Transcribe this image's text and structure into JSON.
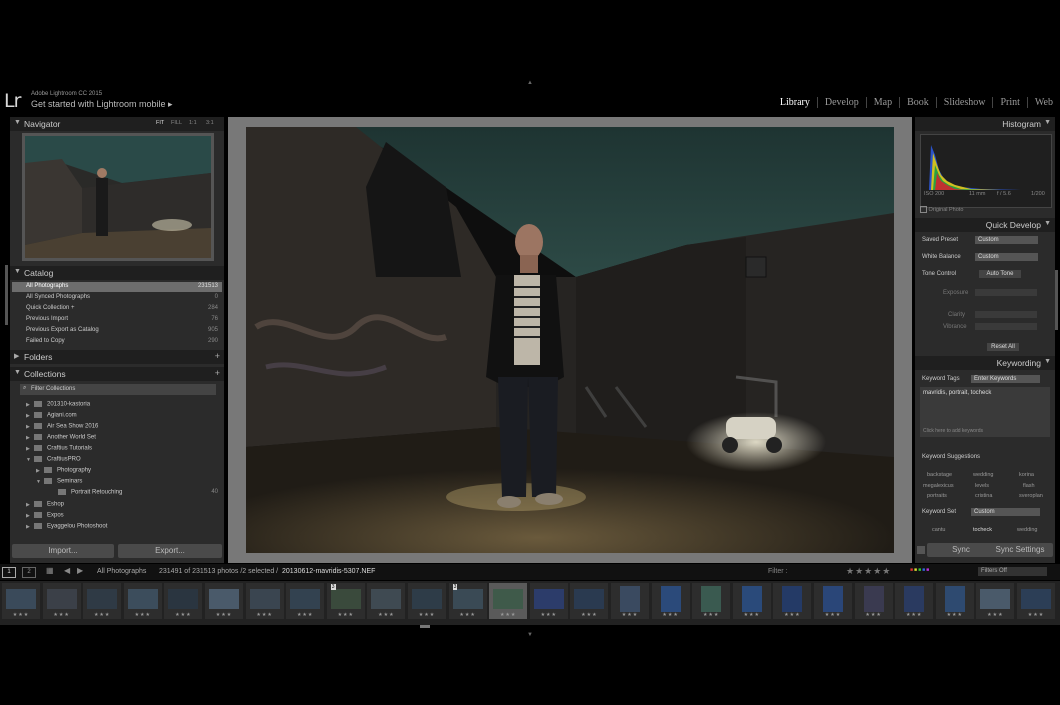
{
  "header": {
    "logo": "Lr",
    "app_name": "Adobe Lightroom CC 2015",
    "get_started": "Get started with Lightroom mobile ▸"
  },
  "modules": [
    "Library",
    "Develop",
    "Map",
    "Book",
    "Slideshow",
    "Print",
    "Web"
  ],
  "active_module": "Library",
  "navigator": {
    "title": "Navigator",
    "zoom": [
      "FIT",
      "FILL",
      "1:1",
      "3:1"
    ]
  },
  "catalog": {
    "title": "Catalog",
    "items": [
      {
        "label": "All Photographs",
        "count": "231513"
      },
      {
        "label": "All Synced Photographs",
        "count": "0"
      },
      {
        "label": "Quick Collection +",
        "count": "284"
      },
      {
        "label": "Previous Import",
        "count": "76"
      },
      {
        "label": "Previous Export as Catalog",
        "count": "905"
      },
      {
        "label": "Failed to Copy",
        "count": "290"
      }
    ]
  },
  "folders": {
    "title": "Folders"
  },
  "collections": {
    "title": "Collections",
    "filter": "Filter Collections",
    "items": [
      {
        "label": "201310-kastoria",
        "count": ""
      },
      {
        "label": "Agiani.com",
        "count": ""
      },
      {
        "label": "Air Sea Show 2016",
        "count": ""
      },
      {
        "label": "Another World Set",
        "count": ""
      },
      {
        "label": "Craftius Tutorials",
        "count": ""
      },
      {
        "label": "CraftiusPRO",
        "count": ""
      },
      {
        "label": "Photography",
        "count": ""
      },
      {
        "label": "Seminars",
        "count": ""
      },
      {
        "label": "Portrait Retouching",
        "count": "40"
      },
      {
        "label": "Eshop",
        "count": ""
      },
      {
        "label": "Expos",
        "count": ""
      },
      {
        "label": "Eyaggelou Photoshoot",
        "count": ""
      }
    ]
  },
  "left_buttons": {
    "import": "Import...",
    "export": "Export..."
  },
  "histogram": {
    "title": "Histogram",
    "iso": "ISO 200",
    "focal": "11 mm",
    "aperture": "f / 5.6",
    "shutter": "1/200",
    "original_photo": "Original Photo"
  },
  "quick_develop": {
    "title": "Quick Develop",
    "saved_preset_label": "Saved Preset",
    "saved_preset_value": "Custom",
    "white_balance_label": "White Balance",
    "white_balance_value": "Custom",
    "tone_control_label": "Tone Control",
    "auto_tone": "Auto Tone",
    "exposure": "Exposure",
    "clarity": "Clarity",
    "vibrance": "Vibrance",
    "reset_all": "Reset All"
  },
  "keywording": {
    "title": "Keywording",
    "tags_label": "Keyword Tags",
    "tags_mode": "Enter Keywords",
    "keywords": "mavridis, portrait, tocheck",
    "add_hint": "Click here to add keywords",
    "suggestions_label": "Keyword Suggestions",
    "suggestions": [
      "backstage",
      "wedding",
      "korina",
      "megalexicus",
      "levels",
      "flash",
      "portraits",
      "cristina",
      "sveroplan"
    ],
    "set_label": "Keyword Set",
    "set_value": "Custom",
    "set_items": [
      "cantu",
      "tocheck",
      "wedding"
    ]
  },
  "sync": {
    "sync": "Sync",
    "sync_settings": "Sync Settings"
  },
  "filmstrip_bar": {
    "page1": "1",
    "page2": "2",
    "source": "All Photographs",
    "info": "231491 of 231513 photos /2 selected /",
    "filename": "20130612-mavridis-5307.NEF",
    "filter_label": "Filter :",
    "filters_off": "Filters Off"
  },
  "thumbs": [
    {
      "kind": "wide",
      "color": "#3a4a5a",
      "sel": false,
      "badge": ""
    },
    {
      "kind": "wide",
      "color": "#3b4048",
      "sel": false,
      "badge": ""
    },
    {
      "kind": "wide",
      "color": "#2f3a45",
      "sel": false,
      "badge": ""
    },
    {
      "kind": "wide",
      "color": "#3c4d5c",
      "sel": false,
      "badge": ""
    },
    {
      "kind": "wide",
      "color": "#2a3540",
      "sel": false,
      "badge": ""
    },
    {
      "kind": "wide",
      "color": "#4a5a6a",
      "sel": false,
      "badge": ""
    },
    {
      "kind": "wide",
      "color": "#3a4550",
      "sel": false,
      "badge": ""
    },
    {
      "kind": "wide",
      "color": "#334250",
      "sel": false,
      "badge": ""
    },
    {
      "kind": "wide",
      "color": "#3a4a3c",
      "sel": false,
      "badge": "3"
    },
    {
      "kind": "wide",
      "color": "#3f4a52",
      "sel": false,
      "badge": ""
    },
    {
      "kind": "wide",
      "color": "#2e3c48",
      "sel": false,
      "badge": ""
    },
    {
      "kind": "wide",
      "color": "#3a4a55",
      "sel": false,
      "badge": "3"
    },
    {
      "kind": "wide",
      "color": "#3f5a4a",
      "sel": true,
      "badge": ""
    },
    {
      "kind": "wide",
      "color": "#2c3c6a",
      "sel": false,
      "badge": ""
    },
    {
      "kind": "wide",
      "color": "#2a3a50",
      "sel": false,
      "badge": ""
    },
    {
      "kind": "vert",
      "color": "#3a4a60",
      "sel": false,
      "badge": ""
    },
    {
      "kind": "vert",
      "color": "#2b4a7a",
      "sel": false,
      "badge": ""
    },
    {
      "kind": "vert",
      "color": "#3a5a50",
      "sel": false,
      "badge": ""
    },
    {
      "kind": "vert",
      "color": "#2a4a7a",
      "sel": false,
      "badge": ""
    },
    {
      "kind": "vert",
      "color": "#243a66",
      "sel": false,
      "badge": ""
    },
    {
      "kind": "vert",
      "color": "#2a4678",
      "sel": false,
      "badge": ""
    },
    {
      "kind": "vert",
      "color": "#3a3a50",
      "sel": false,
      "badge": ""
    },
    {
      "kind": "vert",
      "color": "#2a3a60",
      "sel": false,
      "badge": ""
    },
    {
      "kind": "vert",
      "color": "#2e4a70",
      "sel": false,
      "badge": ""
    },
    {
      "kind": "wide",
      "color": "#4a5a6a",
      "sel": false,
      "badge": ""
    },
    {
      "kind": "wide",
      "color": "#2c3e56",
      "sel": false,
      "badge": ""
    }
  ],
  "thumb_stars": "★★★",
  "colors": {
    "bg": "#000000",
    "panel": "#2b2b2b",
    "panel_header": "#1f1f1f",
    "selected": "#6d6d6d"
  }
}
